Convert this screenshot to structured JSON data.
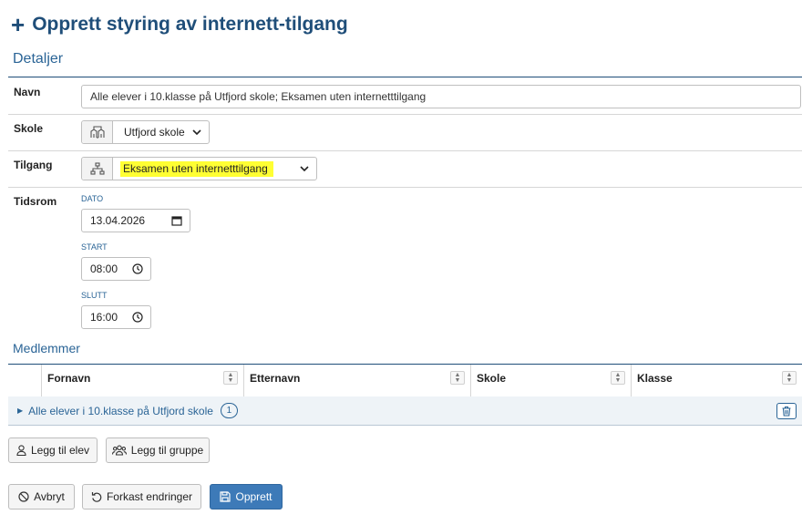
{
  "page": {
    "title": "Opprett styring av internett-tilgang"
  },
  "details": {
    "heading": "Detaljer",
    "name": {
      "label": "Navn",
      "value": "Alle elever i 10.klasse på Utfjord skole; Eksamen uten internetttilgang"
    },
    "school": {
      "label": "Skole",
      "value": "Utfjord skole"
    },
    "access": {
      "label": "Tilgang",
      "value": "Eksamen uten internetttilgang",
      "highlight": "#ffff33"
    },
    "period": {
      "label": "Tidsrom",
      "date_label": "DATO",
      "date_value": "13.04.2026",
      "start_label": "START",
      "start_value": "08:00",
      "end_label": "SLUTT",
      "end_value": "16:00"
    }
  },
  "members": {
    "heading": "Medlemmer",
    "columns": [
      "Fornavn",
      "Etternavn",
      "Skole",
      "Klasse"
    ],
    "groups": [
      {
        "name": "Alle elever i 10.klasse på Utfjord skole",
        "count": "1"
      }
    ],
    "add_student": "Legg til elev",
    "add_group": "Legg til gruppe"
  },
  "actions": {
    "cancel": "Avbryt",
    "discard": "Forkast endringer",
    "create": "Opprett"
  },
  "colors": {
    "accent": "#1f4e79",
    "link": "#2a6496",
    "primary_button": "#3d7ab8"
  }
}
